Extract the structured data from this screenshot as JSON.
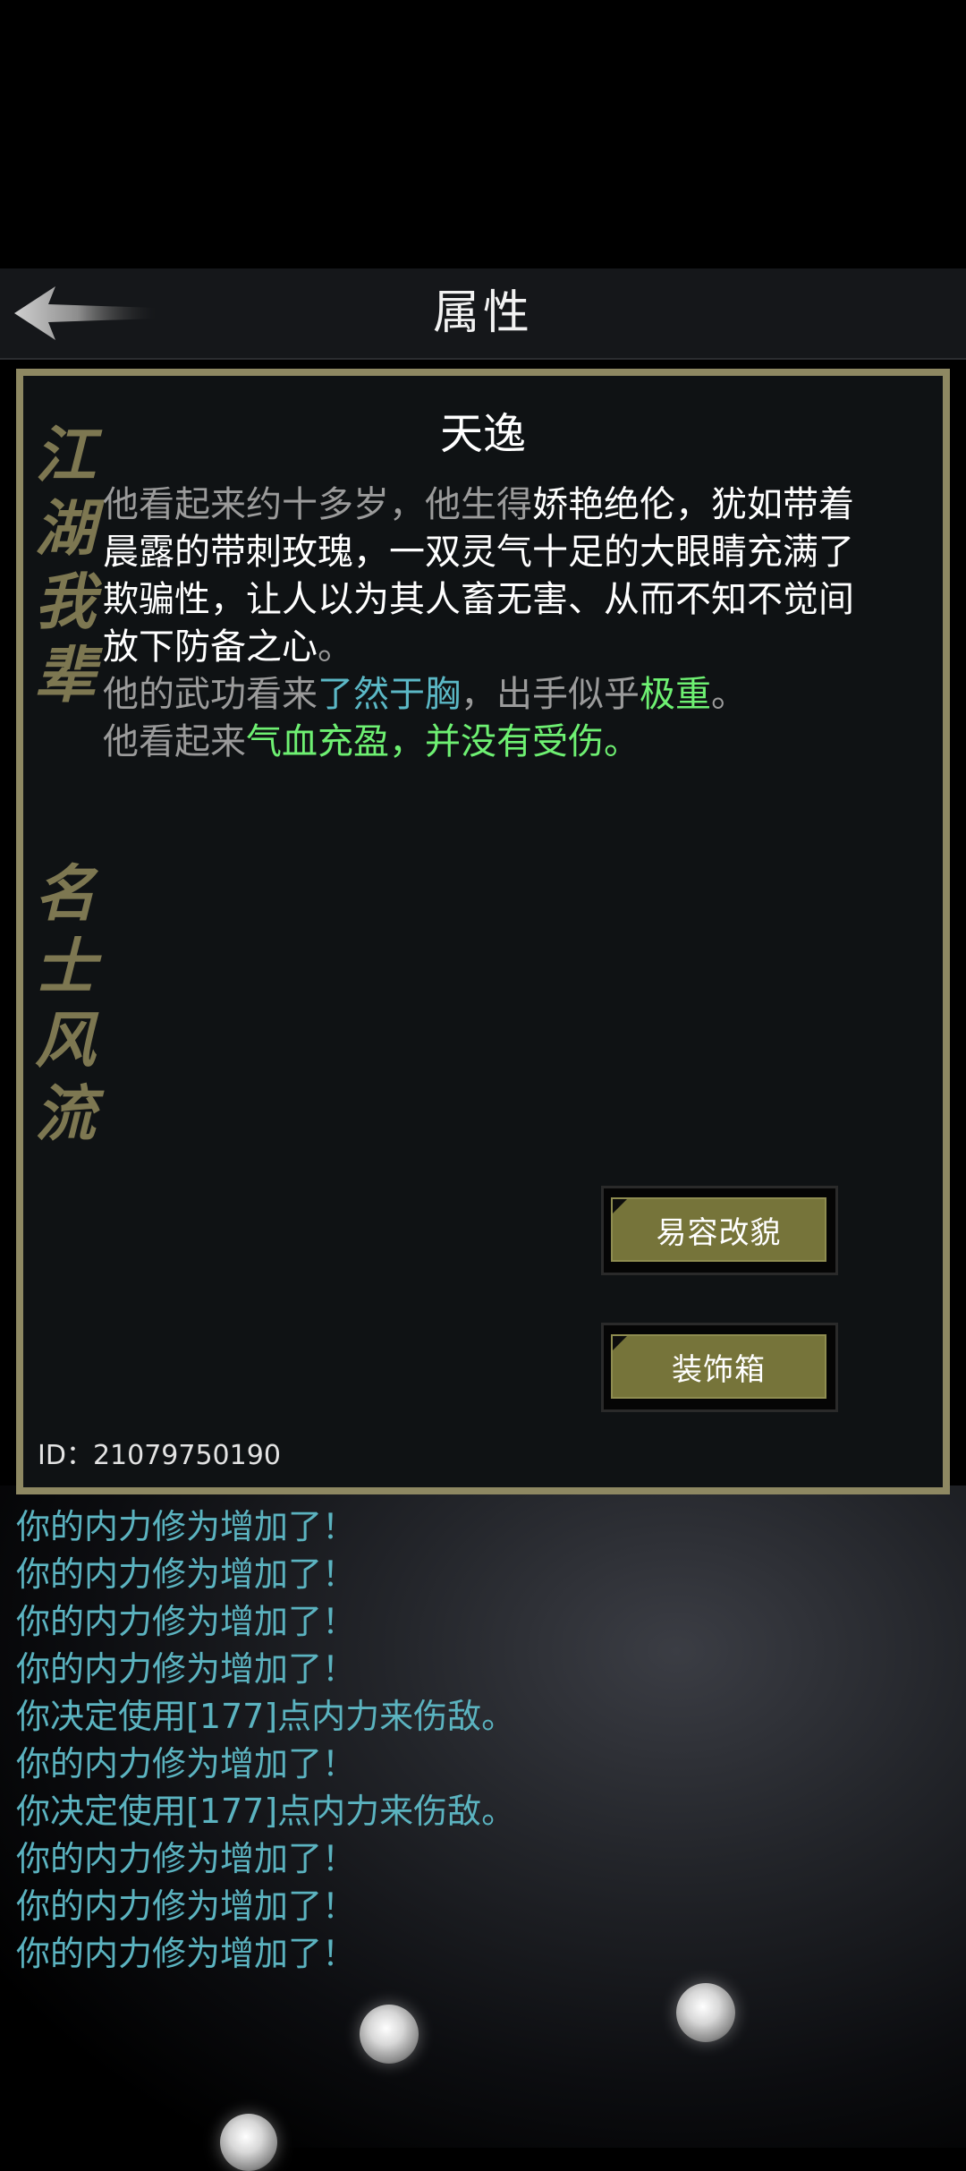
{
  "header": {
    "title": "属性",
    "back_icon": "back-arrow-icon"
  },
  "panel": {
    "calligraphy_1": "江湖我辈",
    "calligraphy_2": "名士风流",
    "character_name": "天逸",
    "description": {
      "p1_gray": "他看起来约十多岁，他生得",
      "p1_white": "娇艳绝伦，犹如带着晨露的带刺玫瑰，一双灵气十足的大眼睛充满了欺骗性，让人以为其人畜无害、从而不知不觉间放下防备之心",
      "p1_end": "。",
      "p2_a": "他的武功看来",
      "p2_b": "了然于胸",
      "p2_c": "，出手似乎",
      "p2_d": "极重",
      "p2_e": "。",
      "p3_a": "他看起来",
      "p3_b": "气血充盈，并没有受伤。"
    },
    "buttons": {
      "disguise": "易容改貌",
      "wardrobe": "装饰箱"
    },
    "player_id": "ID：21079750190"
  },
  "log": [
    "你的内力修为增加了！",
    "你的内力修为增加了！",
    "你的内力修为增加了！",
    "你的内力修为增加了！",
    "你决定使用[177]点内力来伤敌。",
    "你的内力修为增加了！",
    "你决定使用[177]点内力来伤敌。",
    "你的内力修为增加了！",
    "你的内力修为增加了！",
    "你的内力修为增加了！"
  ],
  "colors": {
    "panel_border": "#8e8862",
    "button_face": "#76743a",
    "log_text": "#5bb3c0",
    "highlight_cyan": "#5bb8c6",
    "highlight_green": "#6ef072"
  }
}
